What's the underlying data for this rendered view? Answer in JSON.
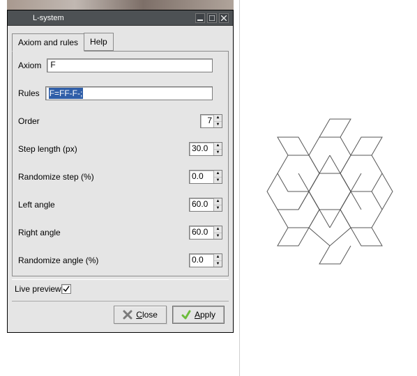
{
  "window": {
    "title": "L-system",
    "tabs": [
      {
        "label": "Axiom and rules",
        "active": true
      },
      {
        "label": "Help",
        "active": false
      }
    ],
    "fields": {
      "axiom": {
        "label": "Axiom",
        "value": "F"
      },
      "rules": {
        "label": "Rules",
        "value": "F=FF-F-;"
      },
      "order": {
        "label": "Order",
        "value": "7"
      },
      "step_length": {
        "label": "Step length (px)",
        "value": "30.0"
      },
      "randomize_step": {
        "label": "Randomize step (%)",
        "value": "0.0"
      },
      "left_angle": {
        "label": "Left angle",
        "value": "60.0"
      },
      "right_angle": {
        "label": "Right angle",
        "value": "60.0"
      },
      "randomize_angle": {
        "label": "Randomize angle (%)",
        "value": "0.0"
      }
    },
    "live_preview": {
      "label": "Live preview",
      "checked": true
    },
    "buttons": {
      "close": "Close",
      "apply": "Apply"
    }
  }
}
